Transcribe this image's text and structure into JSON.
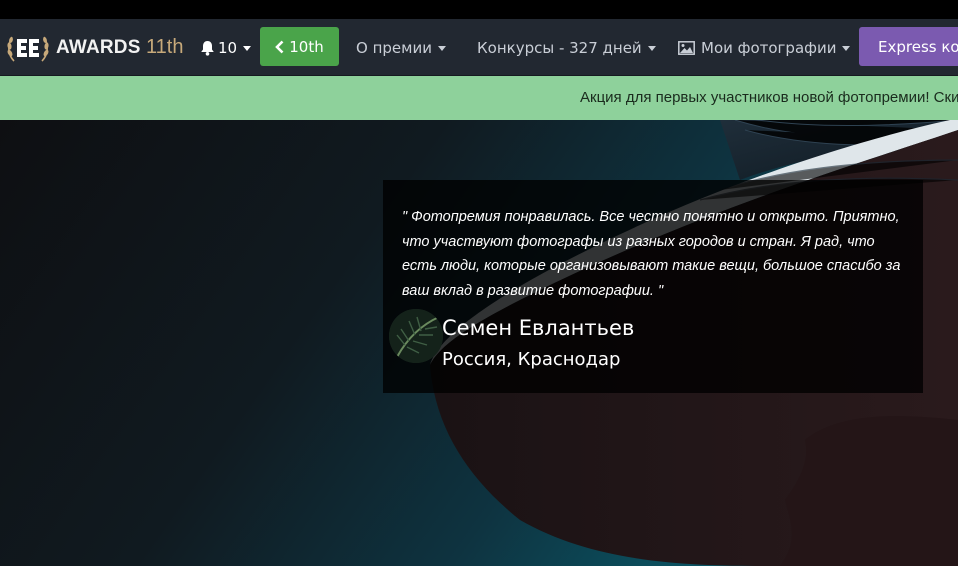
{
  "brand": {
    "name": "AWARDS",
    "edition": "11th"
  },
  "nav": {
    "notifications_count": "10",
    "prev_edition_label": "10th",
    "about_label": "О премии",
    "contests_label": "Конкурсы - 327 дней",
    "photos_label": "Мои фотографии",
    "express_label": "Express конкурс"
  },
  "announcement": {
    "text": "Акция для первых участников новой фотопремии! Скидка"
  },
  "testimonial": {
    "quote": "\" Фотопремия понравилась. Все честно понятно и открыто. Приятно, что участвуют фотографы из разных городов и стран. Я рад, что есть люди, которые организовывают такие вещи, большое спасибо за ваш вклад в развитие фотографии. \"",
    "author": "Семен Евлантьев",
    "location": "Россия, Краснодар"
  },
  "colors": {
    "navbar": "#222831",
    "accent_green": "#4aa44a",
    "accent_purple": "#7b5ab0",
    "announcement_bg": "#8ed19b",
    "edition_gold": "#c7a97a"
  },
  "icons": [
    "laurel-logo-icon",
    "bell-icon",
    "chevron-left-icon",
    "caret-down-icon",
    "image-icon",
    "alarm-clock-icon"
  ]
}
